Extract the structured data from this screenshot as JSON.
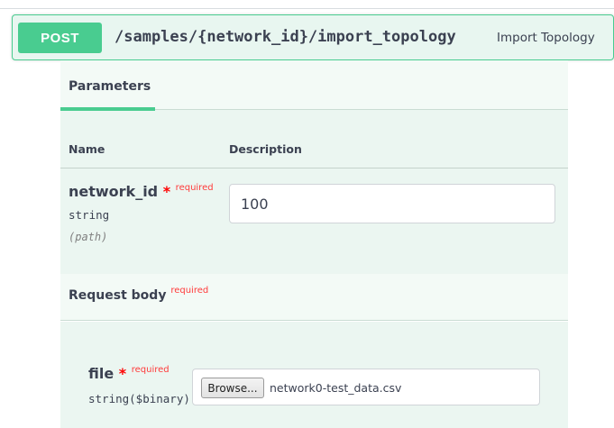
{
  "operation": {
    "method": "POST",
    "path": "/samples/{network_id}/import_topology",
    "summary": "Import Topology"
  },
  "parameters": {
    "tab_label": "Parameters",
    "columns": {
      "name": "Name",
      "description": "Description"
    },
    "items": [
      {
        "name": "network_id",
        "required_star": "*",
        "required_label": "required",
        "type": "string",
        "in": "(path)",
        "value": "100"
      }
    ]
  },
  "request_body": {
    "title": "Request body",
    "required_label": "required",
    "field": {
      "name": "file",
      "required_star": "*",
      "required_label": "required",
      "type": "string($binary)",
      "browse_label": "Browse...",
      "selected_file": "network0-test_data.csv"
    }
  },
  "colors": {
    "post_accent": "#49cc90",
    "summary_bg": "#e8f6f0",
    "panel_bg": "#ebf6f1",
    "required": "#ff0000"
  }
}
